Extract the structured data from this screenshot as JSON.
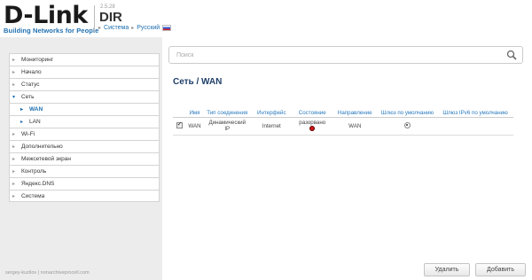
{
  "header": {
    "logo_main": "D-Link",
    "logo_tagline": "Building Networks for People",
    "firmware": "2.5.28",
    "model": "DIR",
    "breadcrumb_system": "Система",
    "breadcrumb_language": "Русский"
  },
  "sidebar": {
    "items": [
      {
        "label": "Мониторинг"
      },
      {
        "label": "Начало"
      },
      {
        "label": "Статус"
      },
      {
        "label": "Сеть"
      },
      {
        "label": "WAN"
      },
      {
        "label": "LAN"
      },
      {
        "label": "Wi-Fi"
      },
      {
        "label": "Дополнительно"
      },
      {
        "label": "Межсетевой экран"
      },
      {
        "label": "Контроль"
      },
      {
        "label": "Яндекс.DNS"
      },
      {
        "label": "Система"
      }
    ]
  },
  "main": {
    "search_placeholder": "Поиск",
    "title": "Сеть /  WAN",
    "table": {
      "columns": [
        "Имя",
        "Тип соединения",
        "Интерфейс",
        "Состояние",
        "Направление",
        "Шлюз по умолчанию",
        "Шлюз IPv6 по умолчанию"
      ],
      "rows": [
        {
          "name": "WAN",
          "type": "Динамический IP",
          "interface": "Internet",
          "state": "разорвано",
          "direction": "WAN"
        }
      ]
    },
    "delete_label": "Удалить",
    "add_label": "Добавить"
  },
  "watermark": "sergey-kuzilov | nonarchiveprocell.com",
  "colors": {
    "accent": "#1f6fb0",
    "status_down": "#c91a1a"
  }
}
